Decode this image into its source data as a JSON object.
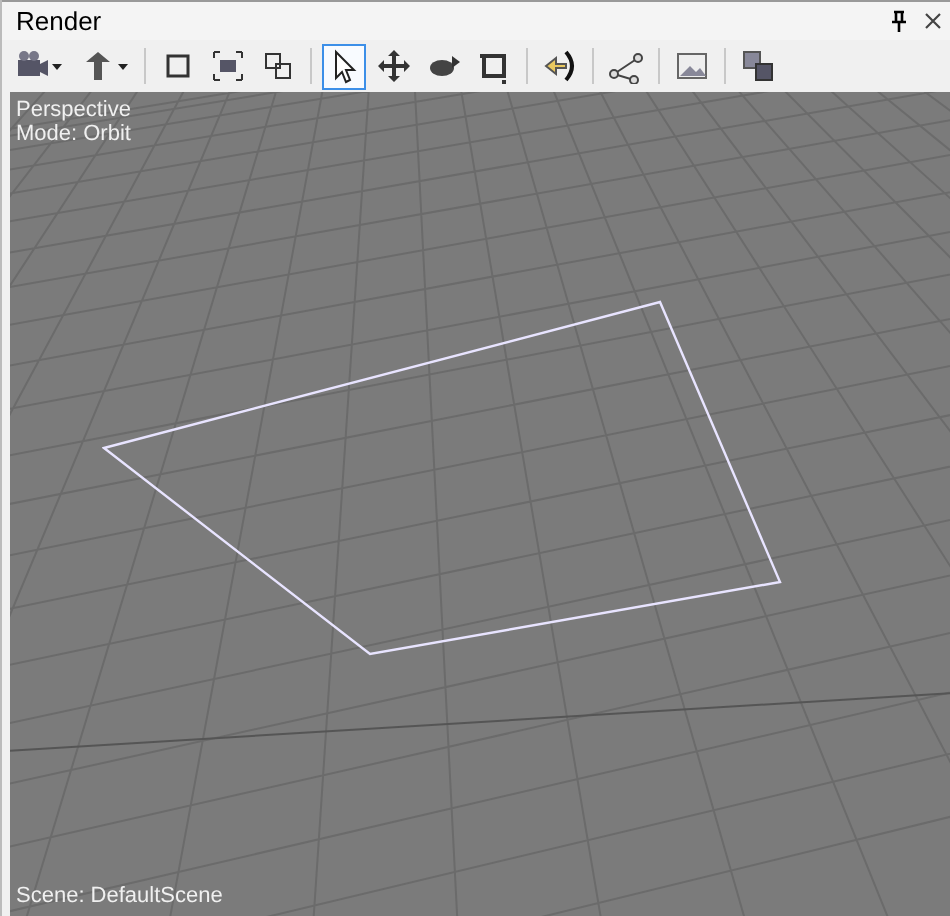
{
  "window": {
    "title": "Render"
  },
  "toolbar": {
    "groups": [
      {
        "tools": [
          {
            "selected": false,
            "dropdown": true
          },
          {
            "selected": false,
            "dropdown": true
          }
        ]
      },
      {
        "tools": [
          {
            "selected": false,
            "dropdown": false
          },
          {
            "selected": false,
            "dropdown": false
          },
          {
            "selected": false,
            "dropdown": false
          }
        ]
      },
      {
        "tools": [
          {
            "selected": true,
            "dropdown": false
          },
          {
            "selected": false,
            "dropdown": false
          },
          {
            "selected": false,
            "dropdown": false
          },
          {
            "selected": false,
            "dropdown": false
          }
        ]
      },
      {
        "tools": [
          {
            "selected": false,
            "dropdown": false
          }
        ]
      },
      {
        "tools": [
          {
            "selected": false,
            "dropdown": false
          }
        ]
      },
      {
        "tools": [
          {
            "selected": false,
            "dropdown": false
          }
        ]
      },
      {
        "tools": [
          {
            "selected": false,
            "dropdown": false
          }
        ]
      }
    ]
  },
  "viewport": {
    "projection": "Perspective",
    "mode": "Mode: Orbit",
    "scene": "Scene: DefaultScene"
  }
}
